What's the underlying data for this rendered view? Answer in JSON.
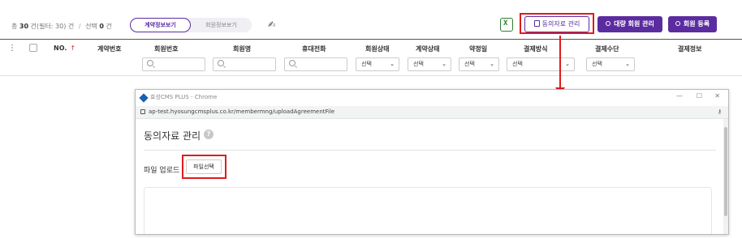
{
  "summary": {
    "total_prefix": "총",
    "total_count": "30",
    "total_suffix": "건(필터: 30) 건",
    "separator": "/",
    "selected_prefix": "선택",
    "selected_count": "0",
    "selected_suffix": "건"
  },
  "view_toggle": {
    "contract_view": "계약정보보기",
    "member_view": "회원정보보기"
  },
  "toolbar": {
    "consent_label": "동의자료 관리",
    "bulk_label": "대량 회원 관리",
    "register_label": "회원 등록"
  },
  "table": {
    "headers": {
      "no": "NO.",
      "contract_no": "계약번호",
      "member_no": "회원번호",
      "member_name": "회원명",
      "mobile": "휴대전화",
      "member_status": "회원상태",
      "contract_status": "계약상태",
      "due_date": "약정일",
      "payment_method": "결제방식",
      "payment_means": "결제수단",
      "payment_info": "결제정보"
    },
    "select_placeholder": "선택"
  },
  "popup": {
    "window_title": "효성CMS PLUS - Chrome",
    "url": "ap-test.hyosungcmsplus.co.kr/membermng/uploadAgreementFile",
    "page_title": "동의자료 관리",
    "help_symbol": "?",
    "upload_label": "파일 업로드",
    "file_button": "파일선택"
  },
  "colors": {
    "brand_purple": "#5b2ca0",
    "highlight_red": "#e01b1b",
    "excel_green": "#2e7d32"
  },
  "icons": [
    "signature-icon",
    "excel-icon",
    "document-icon",
    "users-icon",
    "user-add-icon",
    "search-icon",
    "chevron-down-icon",
    "lock-icon",
    "key-icon",
    "help-icon"
  ]
}
